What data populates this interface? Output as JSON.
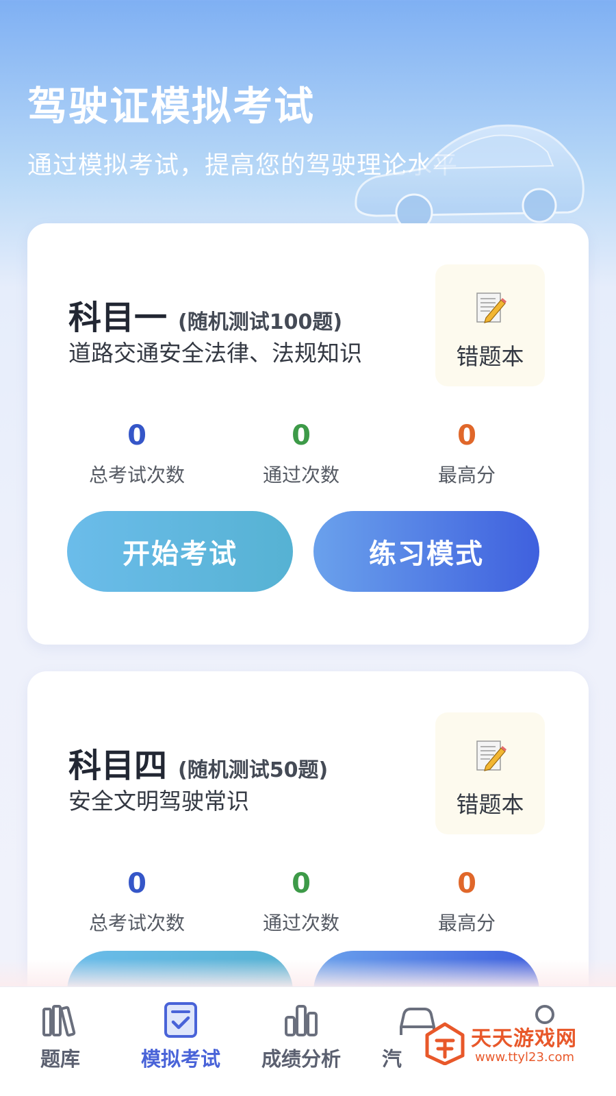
{
  "header": {
    "title": "驾驶证模拟考试",
    "subtitle": "通过模拟考试，提高您的驾驶理论水平"
  },
  "subjects": [
    {
      "name": "科目一",
      "note": "(随机测试100题)",
      "description": "道路交通安全法律、法规知识",
      "wrong_book_label": "错题本",
      "stats": [
        {
          "value": "0",
          "label": "总考试次数"
        },
        {
          "value": "0",
          "label": "通过次数"
        },
        {
          "value": "0",
          "label": "最高分"
        }
      ],
      "start_label": "开始考试",
      "practice_label": "练习模式"
    },
    {
      "name": "科目四",
      "note": "(随机测试50题)",
      "description": "安全文明驾驶常识",
      "wrong_book_label": "错题本",
      "stats": [
        {
          "value": "0",
          "label": "总考试次数"
        },
        {
          "value": "0",
          "label": "通过次数"
        },
        {
          "value": "0",
          "label": "最高分"
        }
      ]
    }
  ],
  "bottom_nav": {
    "items": [
      {
        "label": "题库",
        "icon": "books-icon"
      },
      {
        "label": "模拟考试",
        "icon": "exam-check-icon",
        "active": true
      },
      {
        "label": "成绩分析",
        "icon": "bar-chart-icon"
      },
      {
        "label": "汽",
        "icon": "car-icon"
      },
      {
        "label": "",
        "icon": "user-icon"
      }
    ]
  },
  "watermark": {
    "text": "天天游戏网",
    "url": "www.ttyl23.com"
  },
  "colors": {
    "accent": "#4963d8",
    "stat_total": "#3556c8",
    "stat_pass": "#3d9a48",
    "stat_best": "#e0672a"
  }
}
